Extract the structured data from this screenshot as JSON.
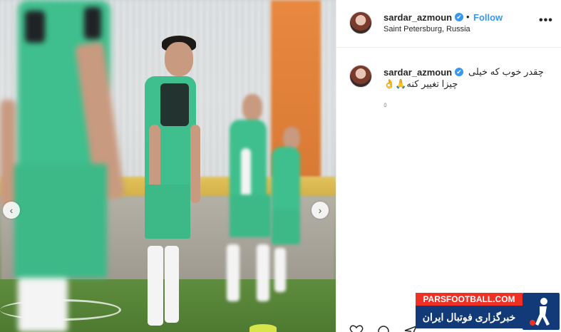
{
  "post": {
    "username": "sardar_azmoun",
    "verified_mark": "✔",
    "separator": "•",
    "follow_label": "Follow",
    "location": "Saint Petersburg, Russia",
    "more_label": "•••"
  },
  "comment": {
    "username": "sardar_azmoun",
    "line1": "چقدر خوب که خیلی",
    "line2": "چیزا تغییر کنه🙏👌",
    "time_glyph": "٥"
  },
  "watermark": {
    "top_text": "PARSFOOTBALL.COM",
    "bottom_text": "خبرگزاری فوتبال ایران"
  },
  "carousel": {
    "prev_label": "‹",
    "next_label": "›"
  },
  "icons": {
    "like": "heart-icon",
    "comment": "comment-icon",
    "share": "share-icon",
    "verified": "verified-badge-icon",
    "more": "more-options-icon"
  },
  "colors": {
    "link_blue": "#3897f0",
    "brand_red": "#ee3124",
    "brand_navy": "#123a78"
  }
}
